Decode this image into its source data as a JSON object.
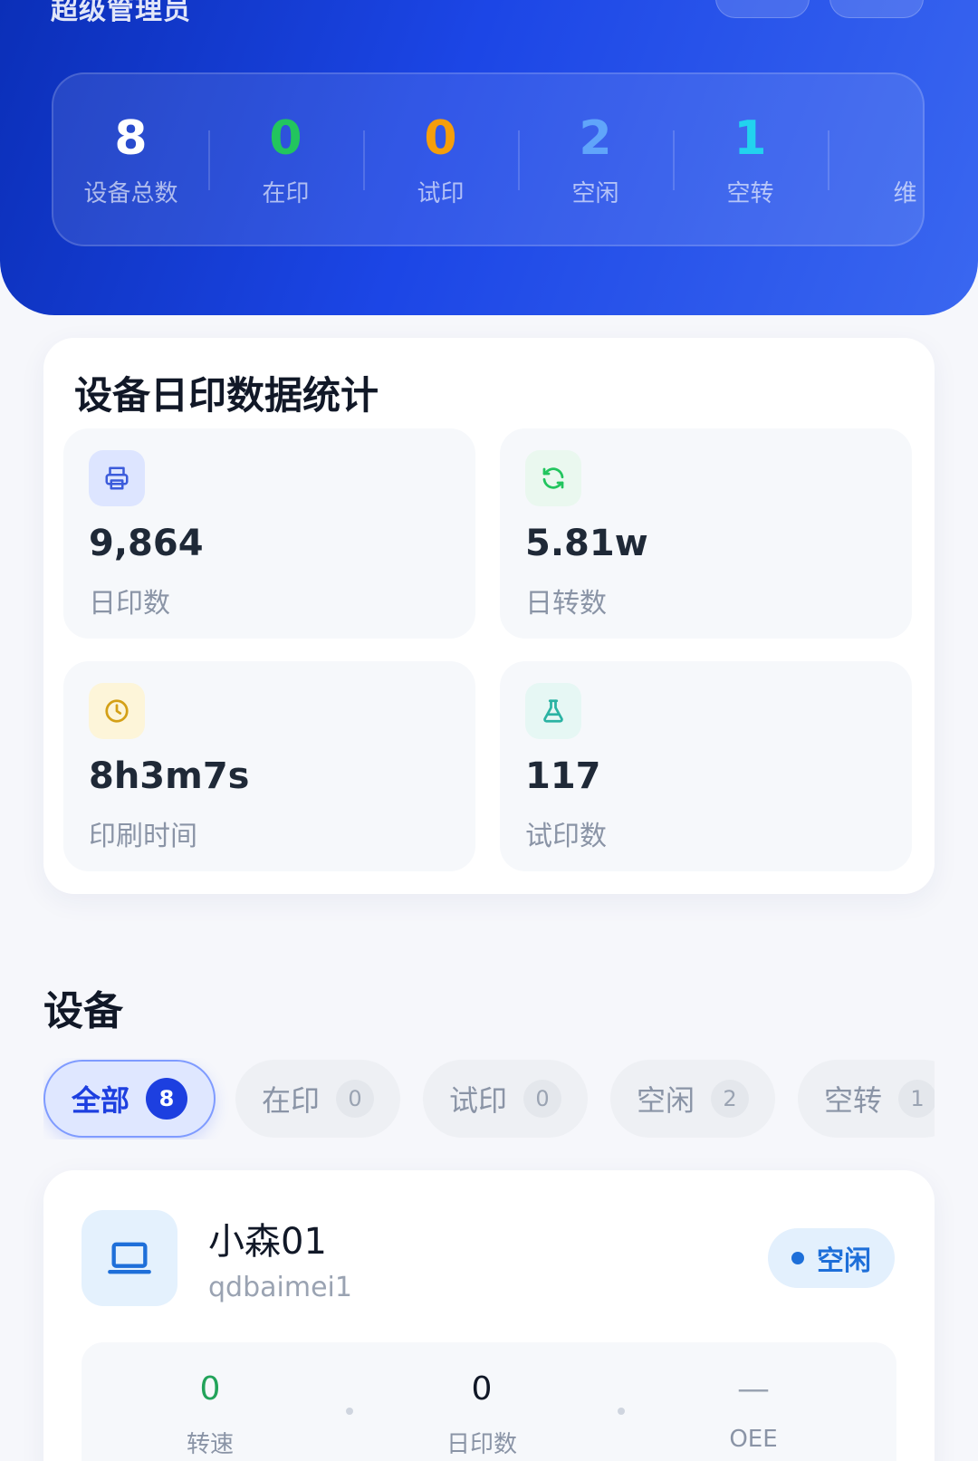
{
  "header": {
    "role_title": "超级管理员",
    "summary": [
      {
        "value": "8",
        "label": "设备总数",
        "color": "#ffffff"
      },
      {
        "value": "0",
        "label": "在印",
        "color": "#22c55e"
      },
      {
        "value": "0",
        "label": "试印",
        "color": "#f59e0b"
      },
      {
        "value": "2",
        "label": "空闲",
        "color": "#60a5fa"
      },
      {
        "value": "1",
        "label": "空转",
        "color": "#22d3ee"
      },
      {
        "value": "",
        "label": "维",
        "color": "#ffffff"
      }
    ]
  },
  "daily_stats": {
    "title": "设备日印数据统计",
    "tiles": [
      {
        "icon": "printer-icon",
        "value": "9,864",
        "label": "日印数",
        "icon_color": "#3b5bdb",
        "icon_bg": "#dde5ff"
      },
      {
        "icon": "refresh-icon",
        "value": "5.81w",
        "label": "日转数",
        "icon_color": "#22c55e",
        "icon_bg": "#eaf8ef"
      },
      {
        "icon": "clock-icon",
        "value": "8h3m7s",
        "label": "印刷时间",
        "icon_color": "#d4a017",
        "icon_bg": "#fdf5d9"
      },
      {
        "icon": "flask-icon",
        "value": "117",
        "label": "试印数",
        "icon_color": "#2bb3a3",
        "icon_bg": "#e6f7f4"
      }
    ]
  },
  "devices": {
    "title": "设备",
    "tabs": [
      {
        "label": "全部",
        "count": "8",
        "active": true
      },
      {
        "label": "在印",
        "count": "0",
        "active": false
      },
      {
        "label": "试印",
        "count": "0",
        "active": false
      },
      {
        "label": "空闲",
        "count": "2",
        "active": false
      },
      {
        "label": "空转",
        "count": "1",
        "active": false
      }
    ],
    "items": [
      {
        "name": "小森01",
        "code": "qdbaimei1",
        "icon": "laptop-icon",
        "status": "空闲",
        "metrics": [
          {
            "value": "0",
            "label": "转速",
            "color": "#22a35a"
          },
          {
            "value": "0",
            "label": "日印数",
            "color": "#111827"
          },
          {
            "value": "—",
            "label": "OEE",
            "color": "#9aa3b2"
          }
        ]
      }
    ]
  }
}
